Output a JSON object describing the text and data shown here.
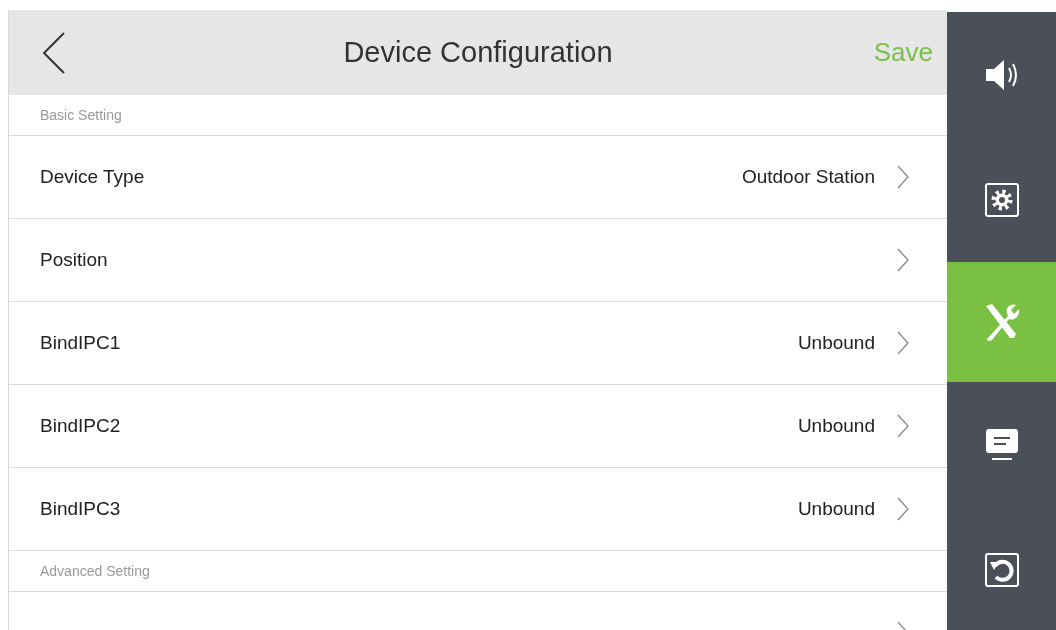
{
  "header": {
    "title": "Device Configuration",
    "save": "Save"
  },
  "sections": [
    {
      "title": "Basic Setting",
      "rows": [
        {
          "label": "Device Type",
          "value": "Outdoor Station"
        },
        {
          "label": "Position"
        },
        {
          "label": "BindIPC1",
          "value": "Unbound"
        },
        {
          "label": "BindIPC2",
          "value": "Unbound"
        },
        {
          "label": "BindIPC3",
          "value": "Unbound"
        }
      ]
    },
    {
      "title": "Advanced Setting",
      "rows": [
        {}
      ]
    }
  ],
  "sidebar": {
    "items": [
      {
        "kind": "speaker",
        "selected": false
      },
      {
        "kind": "settings",
        "selected": false
      },
      {
        "kind": "tools",
        "selected": true
      },
      {
        "kind": "monitor",
        "selected": false
      },
      {
        "kind": "reset",
        "selected": false
      }
    ]
  }
}
